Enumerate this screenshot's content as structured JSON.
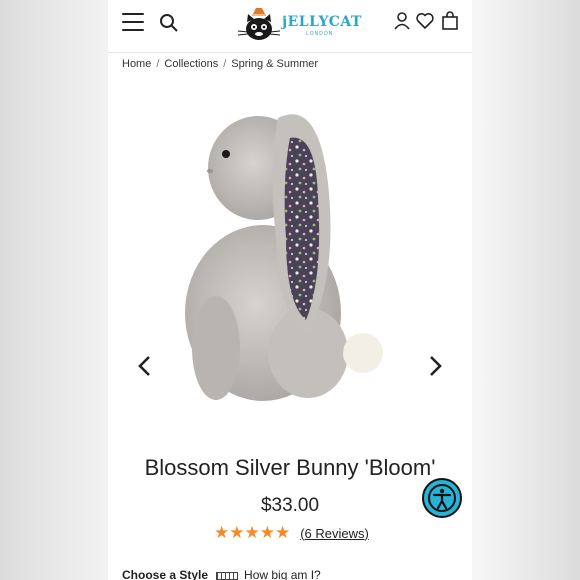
{
  "header": {
    "logo_text": "jELLYCAT",
    "logo_sub": "LONDON"
  },
  "breadcrumb": {
    "items": [
      "Home",
      "Collections",
      "Spring & Summer"
    ],
    "separator": "/"
  },
  "product": {
    "title": "Blossom Silver Bunny 'Bloom'",
    "price": "$33.00",
    "rating_stars": "★★★★★",
    "reviews_label": "(6 Reviews)",
    "rating": 5
  },
  "options": {
    "choose_style_label": "Choose a Style",
    "how_big_label": "How big am I?"
  },
  "colors": {
    "accent": "#2aa6c9",
    "star": "#f28c28",
    "a11y_button": "#26b3d6"
  },
  "icons": [
    "menu-icon",
    "search-icon",
    "account-icon",
    "heart-icon",
    "bag-icon",
    "chevron-left-icon",
    "chevron-right-icon",
    "accessibility-icon",
    "ruler-icon"
  ]
}
